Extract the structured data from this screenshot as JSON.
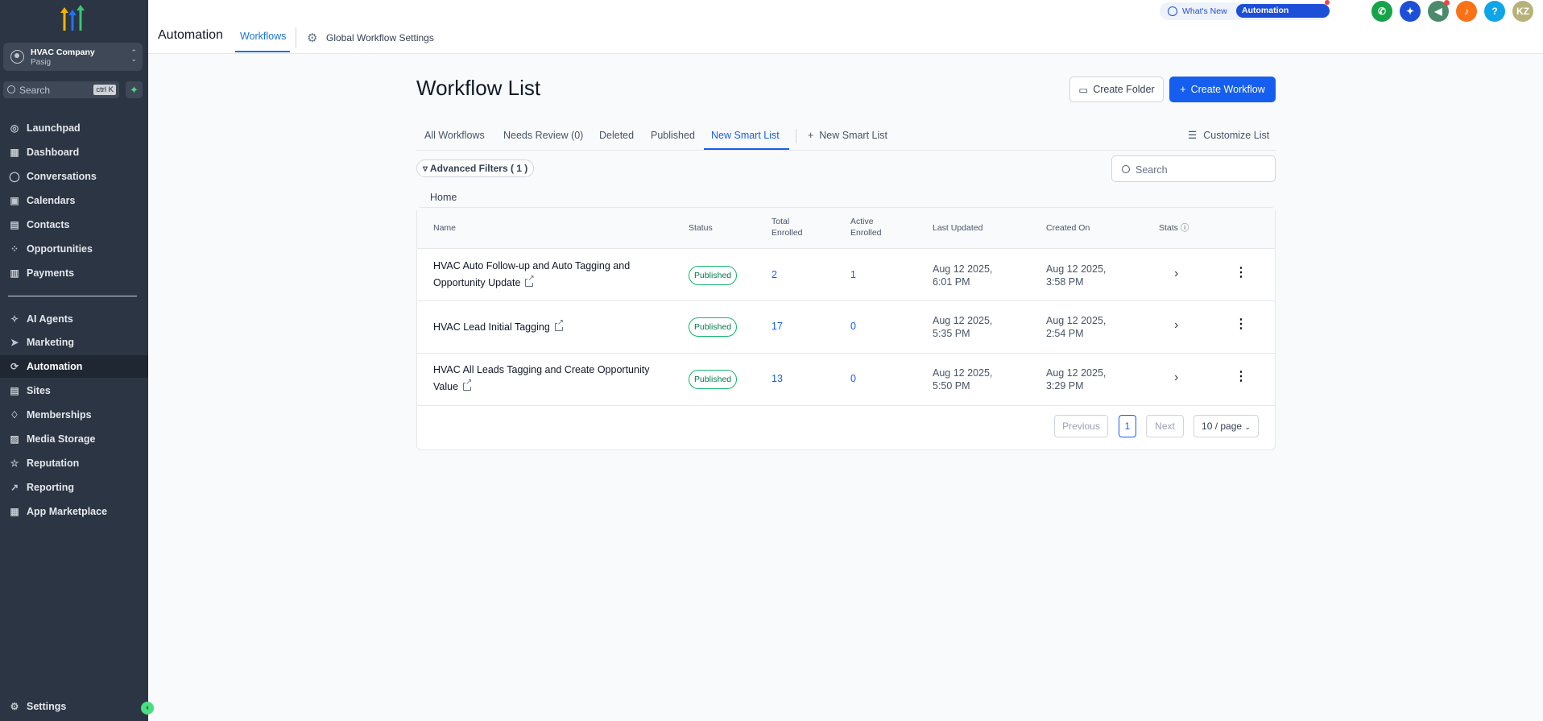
{
  "sidebar": {
    "company": {
      "name": "HVAC Company",
      "location": "Pasig"
    },
    "search": {
      "placeholder": "Search",
      "shortcut": "ctrl K"
    },
    "items": [
      {
        "label": "Launchpad",
        "icon": "rocket-icon"
      },
      {
        "label": "Dashboard",
        "icon": "grid-icon"
      },
      {
        "label": "Conversations",
        "icon": "chat-icon"
      },
      {
        "label": "Calendars",
        "icon": "calendar-icon"
      },
      {
        "label": "Contacts",
        "icon": "contacts-icon"
      },
      {
        "label": "Opportunities",
        "icon": "pipeline-icon"
      },
      {
        "label": "Payments",
        "icon": "receipt-icon"
      },
      {
        "label": "AI Agents",
        "icon": "sparkle-icon"
      },
      {
        "label": "Marketing",
        "icon": "send-icon"
      },
      {
        "label": "Automation",
        "icon": "automation-icon",
        "active": true
      },
      {
        "label": "Sites",
        "icon": "sites-icon"
      },
      {
        "label": "Memberships",
        "icon": "award-icon"
      },
      {
        "label": "Media Storage",
        "icon": "image-icon"
      },
      {
        "label": "Reputation",
        "icon": "star-icon"
      },
      {
        "label": "Reporting",
        "icon": "trend-icon"
      },
      {
        "label": "App Marketplace",
        "icon": "apps-icon"
      }
    ],
    "settings_label": "Settings"
  },
  "topbar": {
    "title": "Automation",
    "tab_workflows": "Workflows",
    "tab_global": "Global Workflow Settings",
    "whats_new": "What's New",
    "automation_updates": "Automation Updates",
    "avatar_initials": "KZ",
    "help": "?"
  },
  "main": {
    "title": "Workflow List",
    "create_folder": "Create Folder",
    "create_workflow": "Create Workflow",
    "tabs": [
      "All Workflows",
      "Needs Review (0)",
      "Deleted",
      "Published",
      "New Smart List"
    ],
    "add_smart_list": "New Smart List",
    "customize_list": "Customize List",
    "advanced_filters": "Advanced Filters ( 1 )",
    "search_placeholder": "Search",
    "breadcrumb": "Home",
    "columns": {
      "name": "Name",
      "status": "Status",
      "total_enrolled": [
        "Total",
        "Enrolled"
      ],
      "active_enrolled": [
        "Active",
        "Enrolled"
      ],
      "last_updated": "Last Updated",
      "created_on": "Created On",
      "stats": "Stats"
    },
    "rows": [
      {
        "name_l1": "HVAC Auto Follow-up and Auto Tagging and",
        "name_l2": "Opportunity Update",
        "status": "Published",
        "total": "2",
        "active": "1",
        "updated_l1": "Aug 12 2025,",
        "updated_l2": "6:01 PM",
        "created_l1": "Aug 12 2025,",
        "created_l2": "3:58 PM"
      },
      {
        "name_l1": "HVAC Lead Initial Tagging",
        "name_l2": "",
        "status": "Published",
        "total": "17",
        "active": "0",
        "updated_l1": "Aug 12 2025,",
        "updated_l2": "5:35 PM",
        "created_l1": "Aug 12 2025,",
        "created_l2": "2:54 PM"
      },
      {
        "name_l1": "HVAC All Leads Tagging and Create Opportunity",
        "name_l2": "Value",
        "status": "Published",
        "total": "13",
        "active": "0",
        "updated_l1": "Aug 12 2025,",
        "updated_l2": "5:50 PM",
        "created_l1": "Aug 12 2025,",
        "created_l2": "3:29 PM"
      }
    ],
    "pagination": {
      "previous": "Previous",
      "current": "1",
      "next": "Next",
      "page_size": "10 / page"
    }
  },
  "colors": {
    "sidebar_bg": "#2b3544",
    "accent": "#155eef",
    "published": "#12b76a"
  }
}
